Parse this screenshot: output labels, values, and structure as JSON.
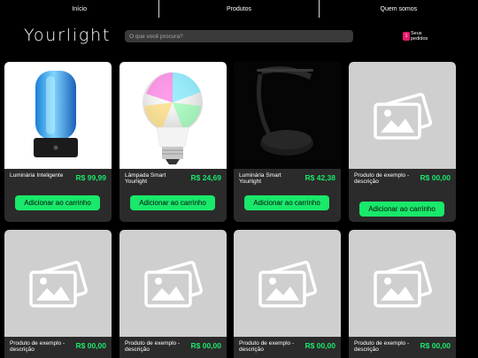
{
  "nav": {
    "items": [
      {
        "label": "Início"
      },
      {
        "label": "Produtos"
      },
      {
        "label": "Quem somos"
      }
    ]
  },
  "header": {
    "logo": "Yourlight",
    "search_placeholder": "O que você procura?",
    "orders_count": "1",
    "orders_label": "Seus pedidos"
  },
  "products": [
    {
      "name": "Luminária Inteligente",
      "price": "R$ 99,99",
      "button": "Adicionar ao carrinho",
      "image": "cylinder-lamp"
    },
    {
      "name": "Lâmpada Smart Yourlight",
      "price": "R$ 24,69",
      "button": "Adicionar ao carrinho",
      "image": "smart-bulb"
    },
    {
      "name": "Luminária Smart Yourlight",
      "price": "R$ 42,38",
      "button": "Adicionar ao carrinho",
      "image": "desk-lamp"
    },
    {
      "name": "Produto de exemplo - descrição",
      "price": "R$ 00,00",
      "button": "Adicionar ao carrinho",
      "image": "image-placeholder-icon"
    },
    {
      "name": "Produto de exemplo - descrição",
      "price": "R$ 00,00",
      "button": "",
      "image": "image-placeholder-icon"
    },
    {
      "name": "Produto de exemplo - descrição",
      "price": "R$ 00,00",
      "button": "",
      "image": "image-placeholder-icon"
    },
    {
      "name": "Produto de exemplo - descrição",
      "price": "R$ 00,00",
      "button": "",
      "image": "image-placeholder-icon"
    },
    {
      "name": "Produto de exemplo - descrição",
      "price": "R$ 00,00",
      "button": "",
      "image": "image-placeholder-icon"
    }
  ],
  "colors": {
    "accent": "#19e86a",
    "badge": "#e6186b",
    "card": "#2b2b2b",
    "background": "#000000",
    "placeholder": "#cfcfcf"
  }
}
